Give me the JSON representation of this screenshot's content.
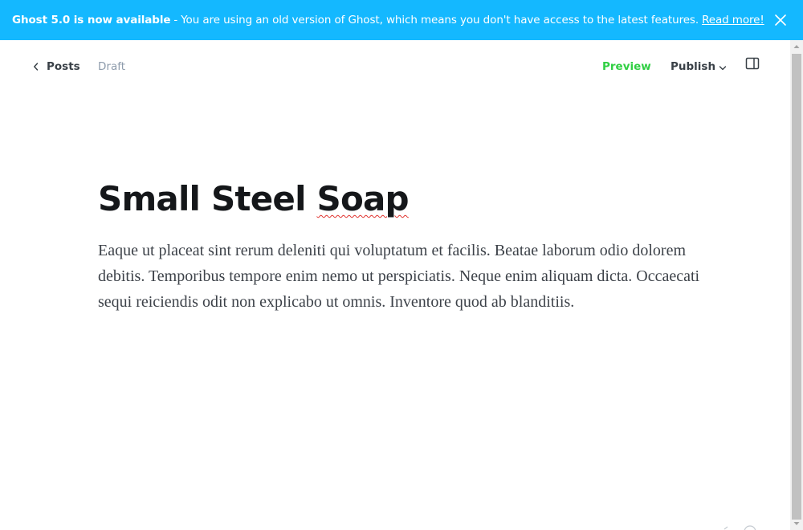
{
  "banner": {
    "strong_text": "Ghost 5.0 is now available",
    "separator": "-",
    "message": "You are using an old version of Ghost, which means you don't have access to the latest features.",
    "link_text": "Read more!",
    "background_color": "#14b8ff"
  },
  "topbar": {
    "back_label": "Posts",
    "status": "Draft",
    "preview_label": "Preview",
    "publish_label": "Publish"
  },
  "post": {
    "title_part1": "Small Steel ",
    "title_misspelled": "Soap",
    "body": "Eaque ut placeat sint rerum deleniti qui voluptatum et facilis. Beatae laborum odio dolorem debitis. Temporibus tempore enim nemo ut perspiciatis. Neque enim aliquam dicta. Occaecati sequi reiciendis odit non explicabo ut omnis. Inventore quod ab blanditiis."
  },
  "colors": {
    "accent_green": "#30cf43",
    "spellcheck_red": "#e0322e"
  },
  "icons": [
    "close-icon",
    "chevron-left-icon",
    "chevron-down-icon",
    "sidebar-toggle-icon"
  ]
}
